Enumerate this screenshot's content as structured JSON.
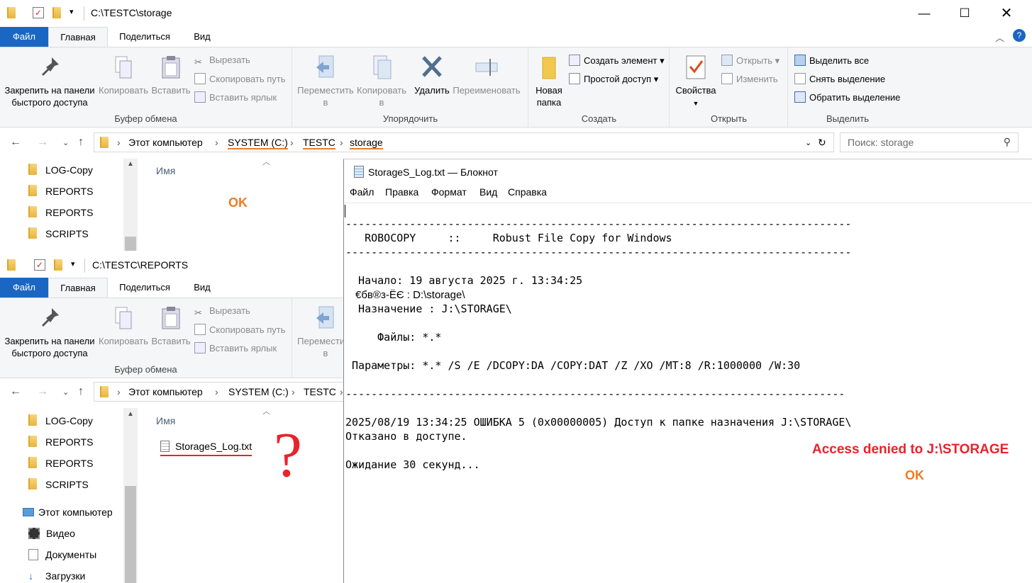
{
  "window1": {
    "path_title": "C:\\TESTC\\storage",
    "tabs": [
      "Файл",
      "Главная",
      "Поделиться",
      "Вид"
    ],
    "ribbon": {
      "pin": "Закрепить на панели быстрого доступа",
      "copy": "Копировать",
      "paste": "Вставить",
      "cut": "Вырезать",
      "copy_path": "Скопировать путь",
      "paste_shortcut": "Вставить ярлык",
      "group_clipboard": "Буфер обмена",
      "move_to": "Переместить в",
      "copy_to": "Копировать в",
      "delete": "Удалить",
      "rename": "Переименовать",
      "group_organize": "Упорядочить",
      "new_folder": "Новая папка",
      "new_item": "Создать элемент",
      "easy_access": "Простой доступ",
      "group_new": "Создать",
      "properties": "Свойства",
      "open": "Открыть",
      "edit": "Изменить",
      "group_open": "Открыть",
      "select_all": "Выделить все",
      "select_none": "Снять выделение",
      "invert_selection": "Обратить выделение",
      "group_select": "Выделить"
    },
    "breadcrumbs": [
      "Этот компьютер",
      "SYSTEM (C:)",
      "TESTC",
      "storage"
    ],
    "search_placeholder": "Поиск: storage",
    "tree": [
      "LOG-Copy",
      "REPORTS",
      "REPORTS",
      "SCRIPTS"
    ],
    "column_name": "Имя"
  },
  "window2": {
    "path_title": "C:\\TESTC\\REPORTS",
    "tabs": [
      "Файл",
      "Главная",
      "Поделиться",
      "Вид"
    ],
    "ribbon": {
      "pin": "Закрепить на панели быстрого доступа",
      "copy": "Копировать",
      "paste": "Вставить",
      "cut": "Вырезать",
      "copy_path": "Скопировать путь",
      "paste_shortcut": "Вставить ярлык",
      "group_clipboard": "Буфер обмена",
      "move_to": "Переместить в"
    },
    "breadcrumbs": [
      "Этот компьютер",
      "SYSTEM (C:)",
      "TESTC"
    ],
    "tree": [
      "LOG-Copy",
      "REPORTS",
      "REPORTS",
      "SCRIPTS"
    ],
    "tree_pc": "Этот компьютер",
    "tree_pc_items": [
      "Видео",
      "Документы",
      "Загрузки"
    ],
    "column_name": "Имя",
    "file": "StorageS_Log.txt"
  },
  "notepad": {
    "title": "StorageS_Log.txt — Блокнот",
    "menu": [
      "Файл",
      "Правка",
      "Формат",
      "Вид",
      "Справка"
    ],
    "lines": [
      "",
      "-------------------------------------------------------------------------------",
      "   ROBOCOPY     ::     Robust File Copy for Windows",
      "-------------------------------------------------------------------------------",
      "",
      "  Начало: 19 августа 2025 г. 13:34:25",
      "",
      "  Назначение : J:\\STORAGE\\",
      "",
      "     Файлы: *.*",
      "",
      " Параметры: *.* /S /E /DCOPY:DA /COPY:DAT /Z /XO /MT:8 /R:1000000 /W:30",
      "",
      "------------------------------------------------------------------------------",
      "",
      "2025/08/19 13:34:25 ОШИБКА 5 (0x00000005) Доступ к папке назначения J:\\STORAGE\\",
      "Отказано в доступе.",
      "",
      "Ожидание 30 секунд..."
    ],
    "garbled_line": "€бв®з-ЁЄ : D:\\storage\\"
  },
  "annotations": {
    "ok1": "OK",
    "access_denied": "Access denied to J:\\STORAGE",
    "ok2": "OK",
    "question": "?"
  },
  "colors": {
    "file_tab": "#1a66c2",
    "annotation_orange": "#f07b22",
    "annotation_red": "#e8232b"
  }
}
